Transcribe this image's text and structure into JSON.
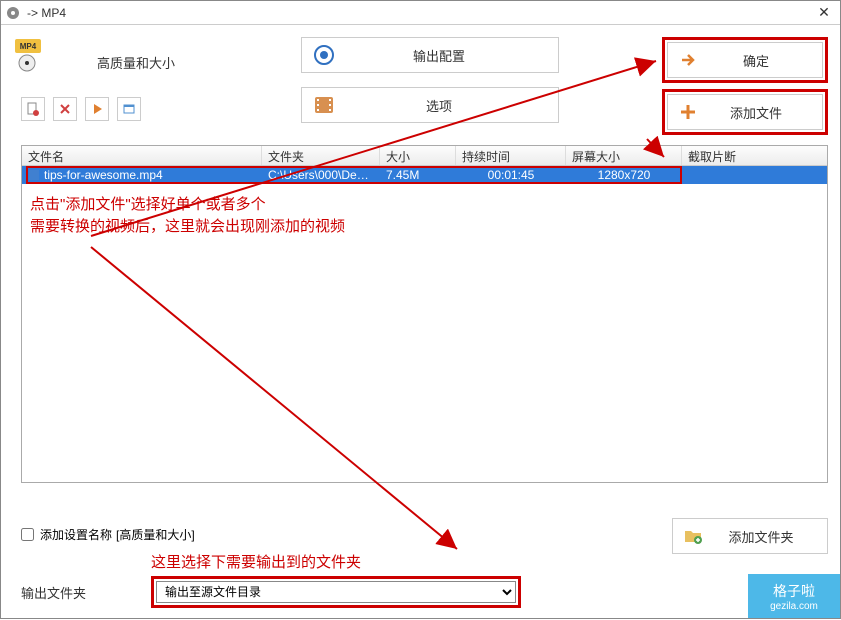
{
  "titlebar": {
    "title": "-> MP4"
  },
  "quality_label": "高质量和大小",
  "center_buttons": {
    "output_config": "输出配置",
    "options": "选项"
  },
  "right_buttons": {
    "ok": "确定",
    "add_file": "添加文件"
  },
  "file_table": {
    "headers": {
      "name": "文件名",
      "folder": "文件夹",
      "size": "大小",
      "duration": "持续时间",
      "screen": "屏幕大小",
      "crop": "截取片断"
    },
    "rows": [
      {
        "name": "tips-for-awesome.mp4",
        "folder": "C:\\Users\\000\\Deskt...",
        "size": "7.45M",
        "duration": "00:01:45",
        "screen": "1280x720",
        "crop": ""
      }
    ]
  },
  "annotations": {
    "line1": "点击\"添加文件\"选择好单个或者多个",
    "line2": "需要转换的视频后，这里就会出现刚添加的视频",
    "bottom": "这里选择下需要输出到的文件夹"
  },
  "bottom": {
    "add_settings_label": "添加设置名称",
    "settings_value": "[高质量和大小]",
    "add_folder": "添加文件夹",
    "output_label": "输出文件夹",
    "output_select": "输出至源文件目录"
  },
  "watermark": {
    "name": "格子啦",
    "url": "gezila.com"
  }
}
